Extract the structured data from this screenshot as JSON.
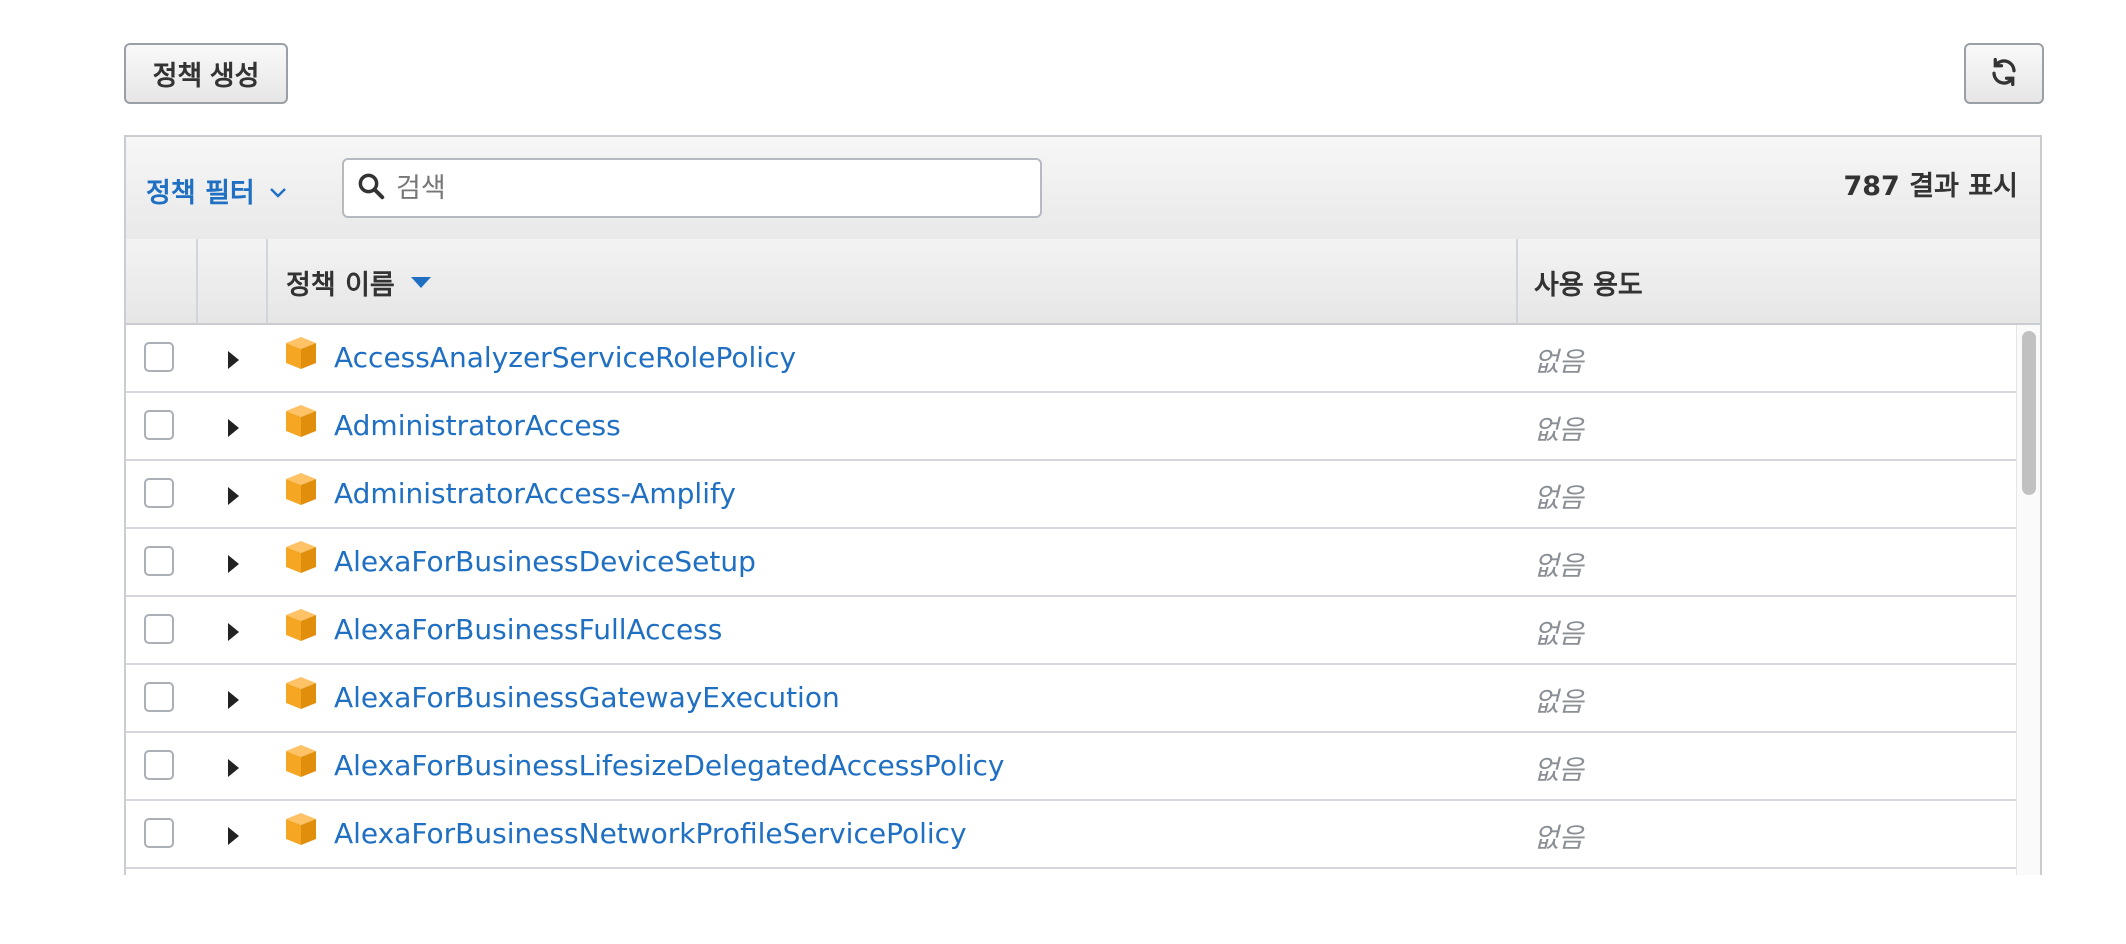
{
  "create_policy_label": "정책 생성",
  "refresh_icon": "refresh-icon",
  "filter": {
    "label": "정책 필터"
  },
  "search": {
    "placeholder": "검색",
    "value": ""
  },
  "result_count": "787 결과 표시",
  "columns": {
    "name": "정책 이름",
    "usage": "사용 용도"
  },
  "colors": {
    "link": "#1f6fc2",
    "package_icon": "#f5a623",
    "usage_text": "#8a8f95"
  },
  "rows": [
    {
      "name": "AccessAnalyzerServiceRolePolicy",
      "usage": "없음"
    },
    {
      "name": "AdministratorAccess",
      "usage": "없음"
    },
    {
      "name": "AdministratorAccess-Amplify",
      "usage": "없음"
    },
    {
      "name": "AlexaForBusinessDeviceSetup",
      "usage": "없음"
    },
    {
      "name": "AlexaForBusinessFullAccess",
      "usage": "없음"
    },
    {
      "name": "AlexaForBusinessGatewayExecution",
      "usage": "없음"
    },
    {
      "name": "AlexaForBusinessLifesizeDelegatedAccessPolicy",
      "usage": "없음"
    },
    {
      "name": "AlexaForBusinessNetworkProfileServicePolicy",
      "usage": "없음"
    }
  ]
}
